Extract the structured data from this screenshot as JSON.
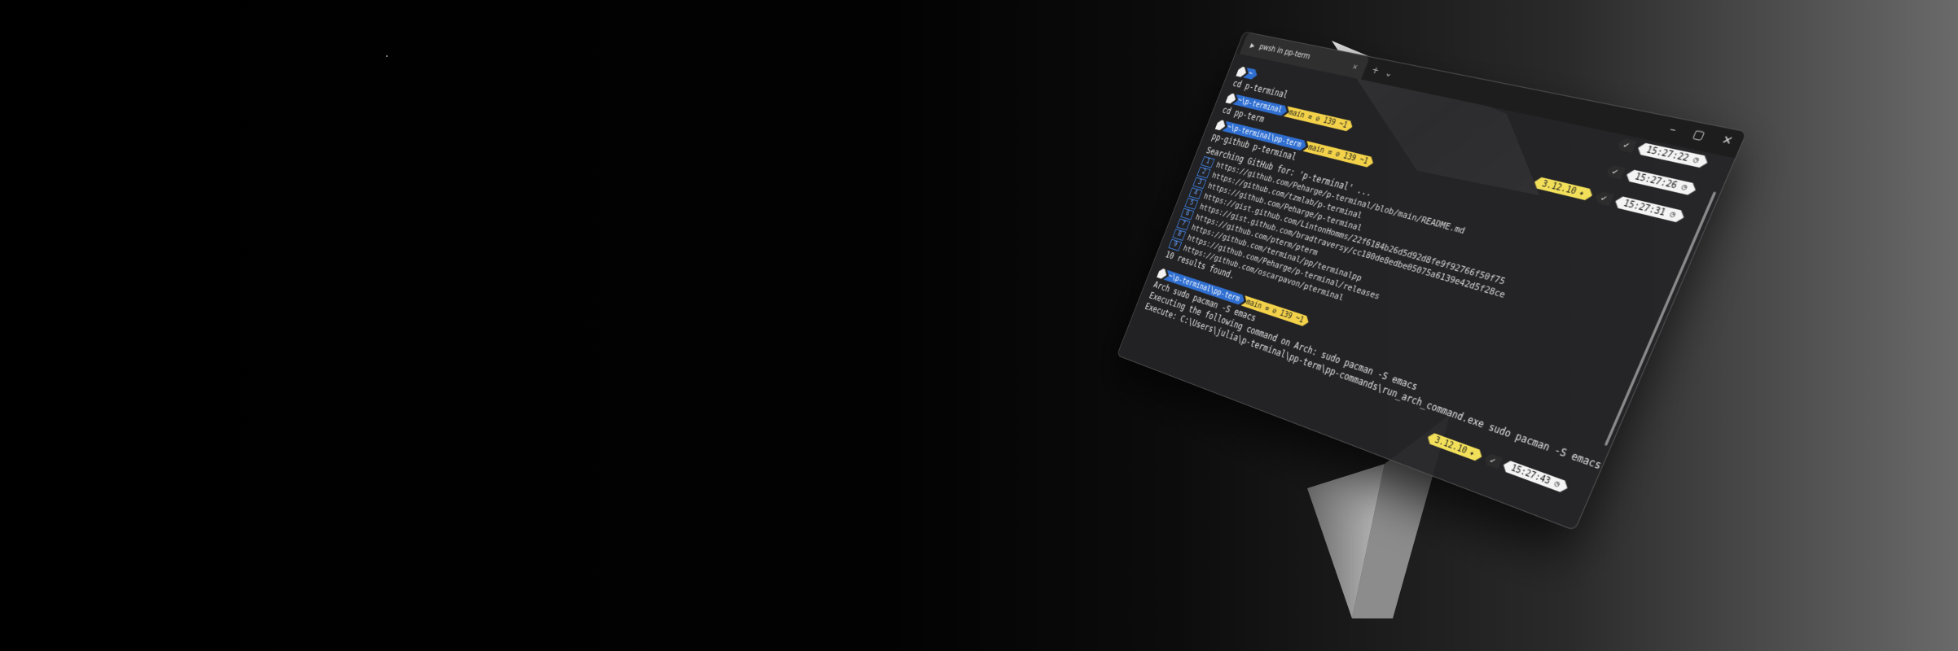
{
  "window": {
    "tab_title": "pwsh in pp-term",
    "tab_icon": "terminal-icon",
    "new_tab": "+",
    "dropdown": "⌄",
    "close_tab": "✕",
    "controls": {
      "minimize": "–",
      "maximize": "▢",
      "close": "✕"
    }
  },
  "prompts": [
    {
      "os": "",
      "folder": "~",
      "git": "",
      "command": "cd p-terminal"
    },
    {
      "os": "",
      "folder": "~\\p-terminal",
      "git": "main ≡ ⊘ 139 ~1",
      "command": "cd pp-term"
    },
    {
      "os": "",
      "folder": "~\\p-terminal\\pp-term",
      "git": "main ≡ ⊘ 139 ~1",
      "command": "pp-github p-terminal"
    }
  ],
  "search_heading": "Searching GitHub for: 'p-terminal' ...",
  "results": [
    {
      "idx": "1",
      "url": "https://github.com/Peharge/p-terminal/blob/main/README.md"
    },
    {
      "idx": "2",
      "url": "https://github.com/tzmlab/p-terminal"
    },
    {
      "idx": "3",
      "url": "https://github.com/Peharge/p-terminal"
    },
    {
      "idx": "4",
      "url": "https://gist.github.com/LintonHomms/22f6184b26d5d92d8fe9f92766f50f75"
    },
    {
      "idx": "5",
      "url": "https://gist.github.com/bradtraversy/cc180de8edbe05075a6139e42d5f28ce"
    },
    {
      "idx": "6",
      "url": "https://github.com/pterm/pterm"
    },
    {
      "idx": "7",
      "url": "https://github.com/terminal/pp/terminalpp"
    },
    {
      "idx": "8",
      "url": "https://github.com/Peharge/p-terminal/releases"
    },
    {
      "idx": "9",
      "url": "https://github.com/oscarpavon/pterminal"
    }
  ],
  "results_footer": "10 results found.",
  "last_prompt": {
    "os": "",
    "folder": "~\\p-terminal\\pp-term",
    "git": "main ≡ ⊘ 139 ~1"
  },
  "last_output": [
    "Arch sudo pacman -S emacs",
    "Executing the following command on Arch: sudo pacman -S emacs",
    "Execute: C:\\Users\\julia\\p-terminal\\pp-term\\pp-commands\\run_arch_command.exe sudo pacman -S emacs"
  ],
  "right_status": [
    {
      "check": "✓",
      "time": "15:27:22",
      "version": ""
    },
    {
      "check": "✓",
      "time": "15:27:26",
      "version": ""
    },
    {
      "check": "✓",
      "time": "15:27:31",
      "version": "3.12.10"
    },
    {
      "check": "✓",
      "time": "15:27:43",
      "version": "3.12.10"
    }
  ]
}
